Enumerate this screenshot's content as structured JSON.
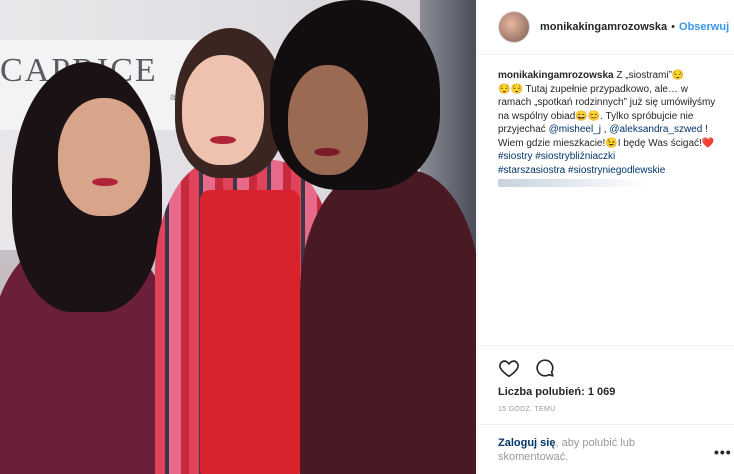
{
  "photo": {
    "banner_text": "CAPRICE",
    "banner_sub": "air"
  },
  "header": {
    "username": "monikakingamrozowska",
    "separator": "•",
    "follow_label": "Obserwuj",
    "avatar_icon": "profile-avatar"
  },
  "caption": {
    "author": "monikakingamrozowska",
    "line1": " Z „siostrami”😌",
    "line2": "😌😌 Tutaj zupełnie przypadkowo, ale… w ramach „spotkań rodzinnych” już się umówiłyśmy na wspólny obiad😄😊. Tylko spróbujcie nie przyjechać ",
    "mention1": "@misheel_j",
    "sep1": " , ",
    "mention2": "@aleksandra_szwed",
    "line3": " ! Wiem gdzie mieszkacie!😉I będę Was ścigać!❤️",
    "tags": [
      "#siostry",
      "#siostrybliźniaczki",
      "#starszasiostra",
      "#siostryniegodlewskie"
    ]
  },
  "actions": {
    "like_icon": "heart-icon",
    "comment_icon": "comment-icon"
  },
  "likes": {
    "text": "Liczba polubień: 1 069"
  },
  "timestamp": "15 GODZ. TEMU",
  "login": {
    "link": "Zaloguj się",
    "rest": ", aby polubić lub skomentować."
  },
  "more_label": "•••",
  "colors": {
    "accent": "#3897f0",
    "link": "#003569",
    "text": "#262626",
    "muted": "#999999"
  }
}
